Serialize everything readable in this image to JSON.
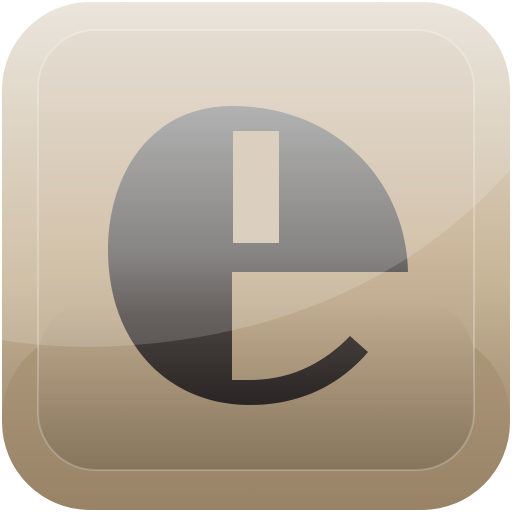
{
  "icon": {
    "name": "e-letter-app-icon",
    "glyph": "e",
    "colors": {
      "tile_top": "#e4dbcf",
      "tile_mid": "#c6b395",
      "tile_bottom": "#a38d6f",
      "tile_edge": "#806f5a",
      "glyph_top": "#9a9a9a",
      "glyph_bottom": "#2b2625"
    }
  }
}
